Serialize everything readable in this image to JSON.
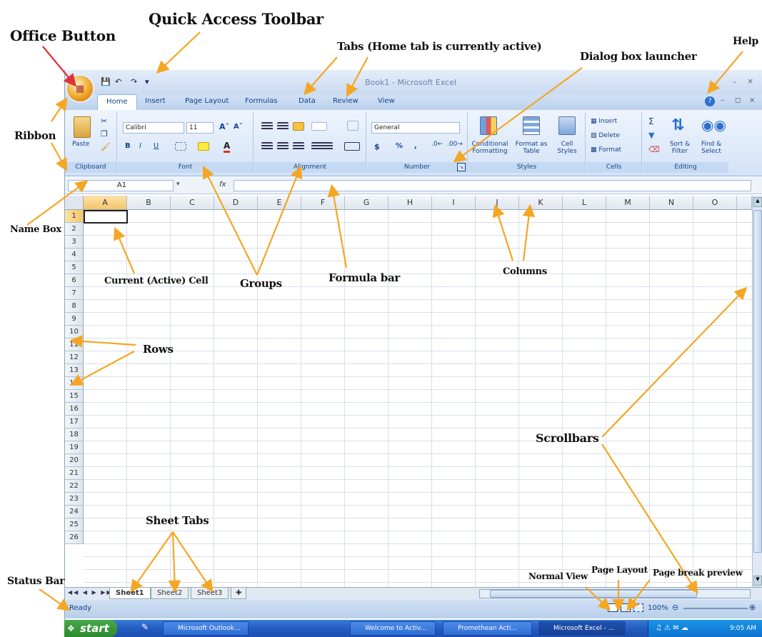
{
  "annotations": {
    "office_button": "Office Button",
    "quick_access": "Quick Access Toolbar",
    "tabs": "Tabs (Home tab is currently active)",
    "dialog_launcher": "Dialog box launcher",
    "help": "Help",
    "ribbon": "Ribbon",
    "name_box": "Name Box",
    "active_cell": "Current (Active) Cell",
    "groups": "Groups",
    "formula_bar": "Formula bar",
    "columns": "Columns",
    "rows": "Rows",
    "scrollbars": "Scrollbars",
    "sheet_tabs": "Sheet Tabs",
    "status_bar": "Status Bar",
    "normal_view": "Normal View",
    "page_layout": "Page Layout",
    "page_break": "Page break preview"
  },
  "window": {
    "title": "Book1 - Microsoft Excel"
  },
  "tabs": [
    "Home",
    "Insert",
    "Page Layout",
    "Formulas",
    "Data",
    "Review",
    "View"
  ],
  "ribbon": {
    "clipboard": {
      "label": "Clipboard",
      "paste": "Paste"
    },
    "font": {
      "label": "Font",
      "name": "Calibri",
      "size": "11",
      "bold": "B",
      "italic": "I",
      "underline": "U"
    },
    "alignment": {
      "label": "Alignment"
    },
    "number": {
      "label": "Number",
      "format": "General",
      "currency": "$",
      "percent": "%"
    },
    "styles": {
      "label": "Styles",
      "conditional": "Conditional Formatting",
      "format_table": "Format as Table",
      "cell_styles": "Cell Styles"
    },
    "cells": {
      "label": "Cells",
      "insert": "Insert",
      "delete": "Delete",
      "format": "Format"
    },
    "editing": {
      "label": "Editing",
      "sort": "Sort & Filter",
      "find": "Find & Select"
    }
  },
  "formula": {
    "name_box": "A1",
    "fx": "fx"
  },
  "columns": [
    "A",
    "B",
    "C",
    "D",
    "E",
    "F",
    "G",
    "H",
    "I",
    "J",
    "K",
    "L",
    "M",
    "N",
    "O"
  ],
  "rows": [
    "1",
    "2",
    "3",
    "4",
    "5",
    "6",
    "7",
    "8",
    "9",
    "10",
    "11",
    "12",
    "13",
    "14",
    "15",
    "16",
    "17",
    "18",
    "19",
    "20",
    "21",
    "22",
    "23",
    "24",
    "25",
    "26"
  ],
  "sheets": [
    "Sheet1",
    "Sheet2",
    "Sheet3"
  ],
  "status": {
    "text": "Ready",
    "zoom": "100%"
  },
  "taskbar": {
    "start": "start",
    "items": [
      "Microsoft Outlook...",
      "Welcome to Activ...",
      "Promethean Acti...",
      "Microsoft Excel - ..."
    ],
    "clock": "9:05 AM"
  },
  "colors": {
    "accent": "#15428b",
    "arrow": "#f5a623",
    "ribbon": "#d4e3f7",
    "taskbar": "#235cc0"
  }
}
